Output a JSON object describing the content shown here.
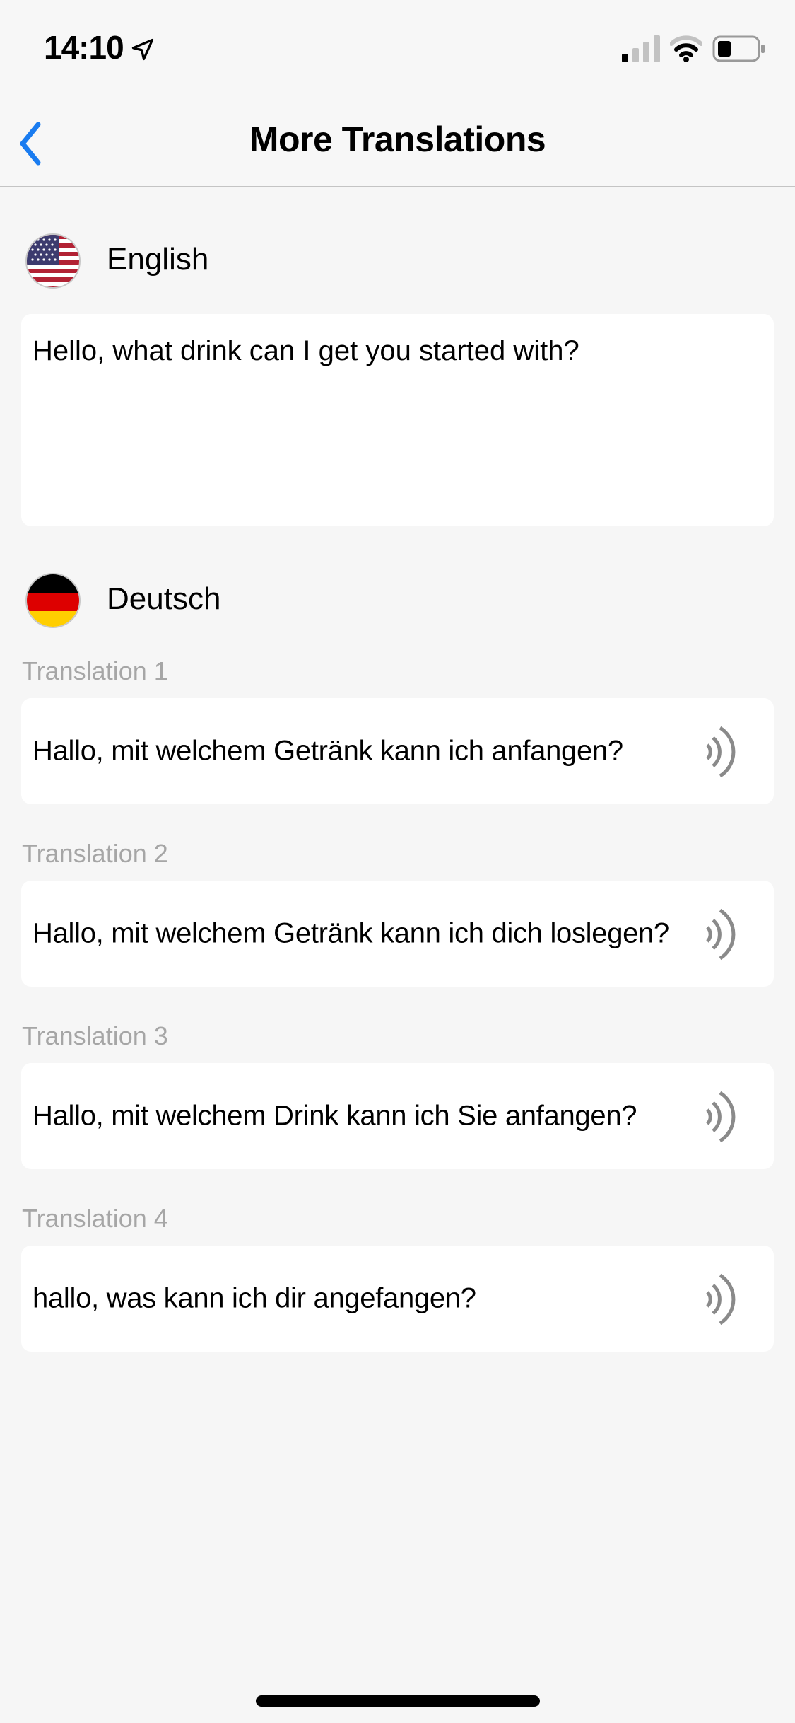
{
  "status_bar": {
    "time": "14:10",
    "location_icon": "location-arrow-icon",
    "signal_icon": "cellular-signal-icon",
    "wifi_icon": "wifi-icon",
    "battery_icon": "battery-icon"
  },
  "nav": {
    "title": "More Translations",
    "back_icon": "chevron-left-icon"
  },
  "colors": {
    "accent": "#1a7cf0",
    "background": "#f6f6f6",
    "card": "#ffffff",
    "label_gray": "#a6a6a6",
    "speaker_gray": "#8a8a8a"
  },
  "source": {
    "language": "English",
    "flag_icon": "us-flag-icon",
    "text": "Hello, what drink can I get you started with?"
  },
  "target": {
    "language": "Deutsch",
    "flag_icon": "german-flag-icon"
  },
  "translations": [
    {
      "label": "Translation 1",
      "text": "Hallo, mit welchem Getränk kann ich anfangen?"
    },
    {
      "label": "Translation 2",
      "text": "Hallo, mit welchem Getränk kann ich dich loslegen?"
    },
    {
      "label": "Translation 3",
      "text": "Hallo, mit welchem Drink kann ich Sie anfangen?"
    },
    {
      "label": "Translation 4",
      "text": "hallo, was kann ich dir angefangen?"
    }
  ]
}
